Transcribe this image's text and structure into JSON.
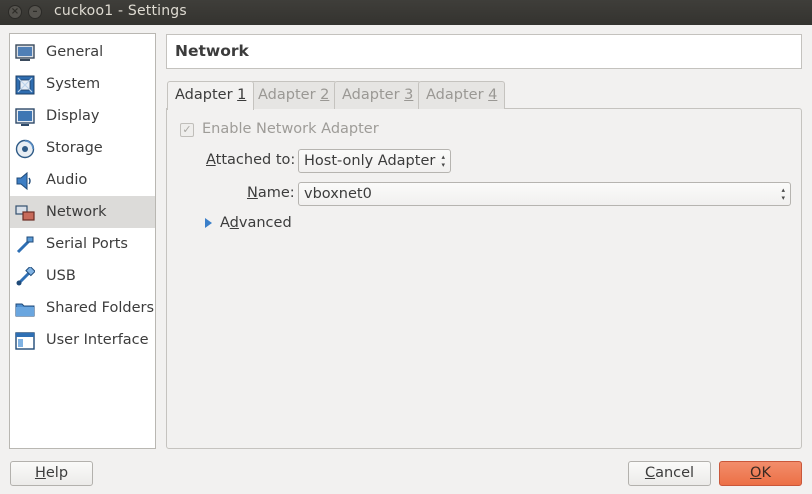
{
  "window": {
    "title": "cuckoo1 - Settings",
    "close_glyph": "×",
    "min_glyph": "–"
  },
  "sidebar": {
    "items": [
      {
        "label": "General",
        "icon": "general-icon"
      },
      {
        "label": "System",
        "icon": "system-icon"
      },
      {
        "label": "Display",
        "icon": "display-icon"
      },
      {
        "label": "Storage",
        "icon": "storage-icon"
      },
      {
        "label": "Audio",
        "icon": "audio-icon"
      },
      {
        "label": "Network",
        "icon": "network-icon",
        "selected": true
      },
      {
        "label": "Serial Ports",
        "icon": "serial-ports-icon"
      },
      {
        "label": "USB",
        "icon": "usb-icon"
      },
      {
        "label": "Shared Folders",
        "icon": "shared-folders-icon"
      },
      {
        "label": "User Interface",
        "icon": "user-interface-icon"
      }
    ]
  },
  "header": {
    "title": "Network"
  },
  "tabs": [
    {
      "prefix": "Adapter ",
      "mnemonic": "1",
      "active": true
    },
    {
      "prefix": "Adapter ",
      "mnemonic": "2",
      "active": false
    },
    {
      "prefix": "Adapter ",
      "mnemonic": "3",
      "active": false
    },
    {
      "prefix": "Adapter ",
      "mnemonic": "4",
      "active": false
    }
  ],
  "adapter": {
    "enable_label": "Enable Network Adapter",
    "enable_checked": true,
    "enable_check_glyph": "✓",
    "attached_label_pre": "",
    "attached_label_mn": "A",
    "attached_label_post": "ttached to:",
    "attached_value": "Host-only Adapter",
    "name_label_pre": "",
    "name_label_mn": "N",
    "name_label_post": "ame:",
    "name_value": "vboxnet0",
    "advanced_pre": "A",
    "advanced_mn": "d",
    "advanced_post": "vanced",
    "select_arrows": "▲\n▼"
  },
  "buttons": {
    "help_mn": "H",
    "help_rest": "elp",
    "cancel_mn": "C",
    "cancel_rest": "ancel",
    "ok_mn": "O",
    "ok_rest": "K"
  },
  "colors": {
    "accent_ok": "#ec7046",
    "expander": "#3b7fc9",
    "titlebar": "#3c3b37"
  }
}
